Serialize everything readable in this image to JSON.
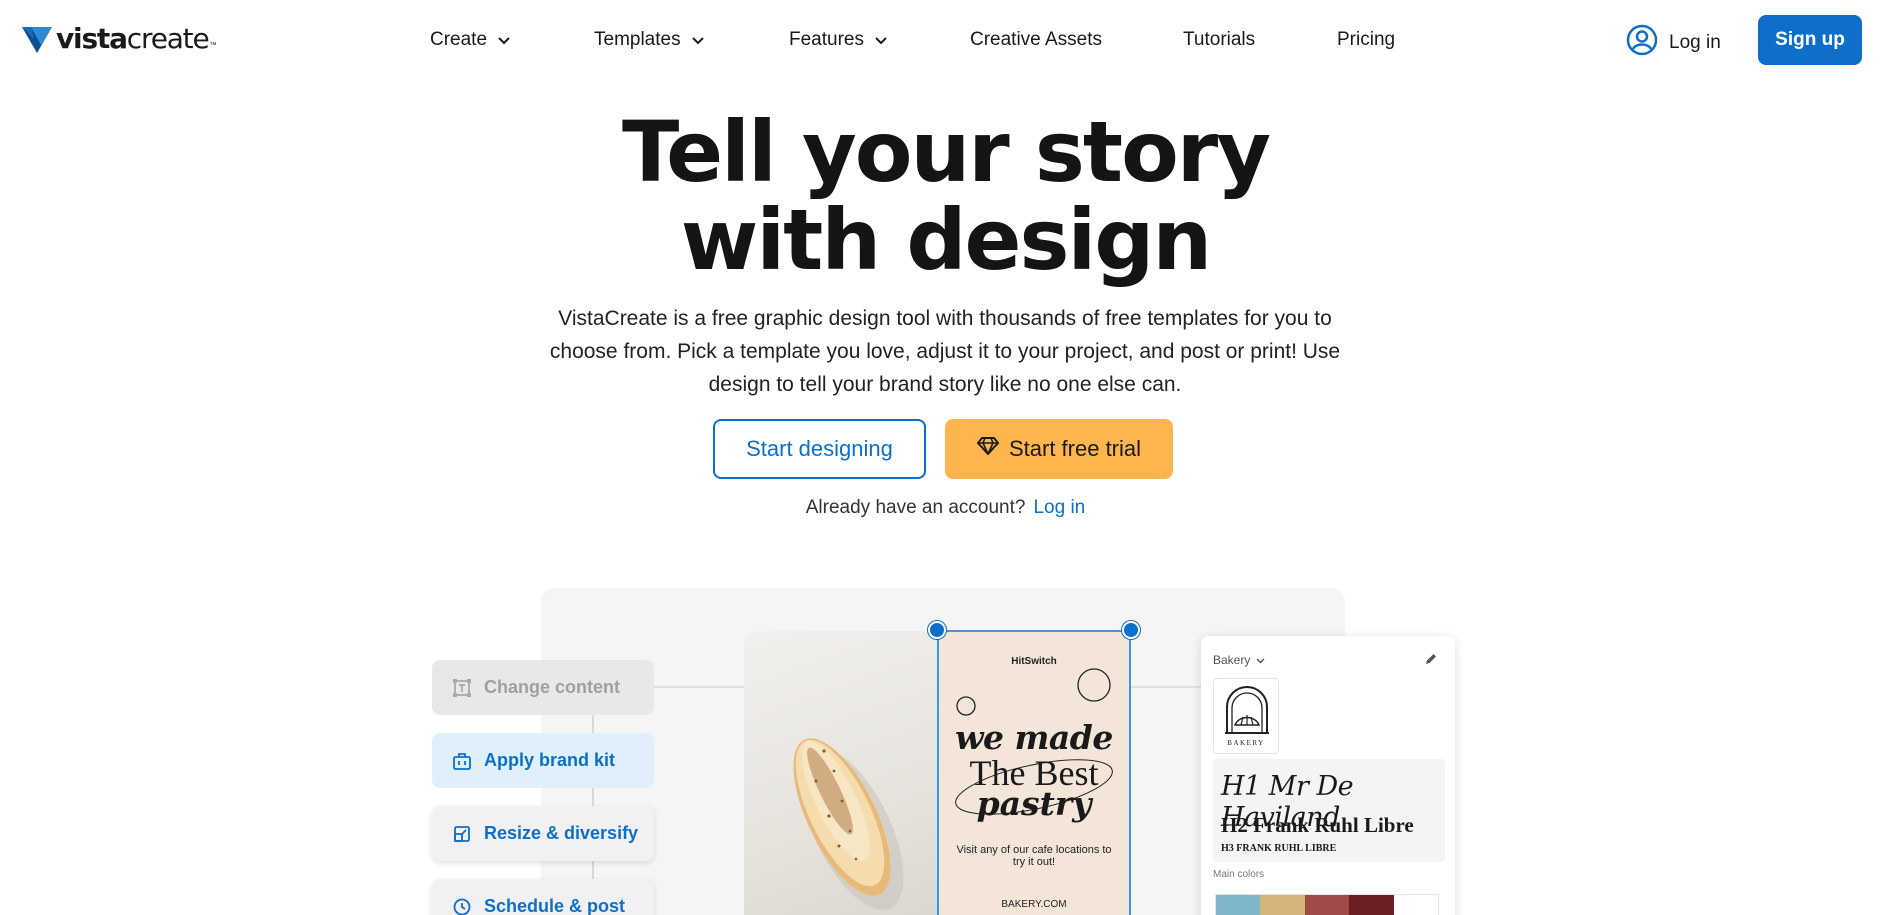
{
  "header": {
    "logo": {
      "text_bold": "vista",
      "text_light": "create",
      "tm": "™"
    },
    "nav": [
      {
        "label": "Create",
        "has_dropdown": true
      },
      {
        "label": "Templates",
        "has_dropdown": true
      },
      {
        "label": "Features",
        "has_dropdown": true
      },
      {
        "label": "Creative Assets",
        "has_dropdown": false
      },
      {
        "label": "Tutorials",
        "has_dropdown": false
      },
      {
        "label": "Pricing",
        "has_dropdown": false
      }
    ],
    "login_label": "Log in",
    "signup_label": "Sign up",
    "icons": {
      "dropdown": "chevron-down-icon",
      "user": "user-circle-icon"
    }
  },
  "hero": {
    "title_line1": "Tell your story",
    "title_line2": "with design",
    "subtitle": "VistaCreate is a free graphic design tool with thousands of free templates for you to choose from. Pick a template you love, adjust it to your project, and post or print! Use design to tell your brand story like no one else can.",
    "start_designing": "Start designing",
    "start_trial": "Start free trial",
    "already_text": "Already have an account?",
    "login_link": "Log in"
  },
  "illustration": {
    "steps": [
      {
        "label": "Change content",
        "icon": "text-frame-icon",
        "state": "disabled"
      },
      {
        "label": "Apply brand kit",
        "icon": "briefcase-icon",
        "state": "active"
      },
      {
        "label": "Resize & diversify",
        "icon": "resize-icon",
        "state": "default"
      },
      {
        "label": "Schedule & post",
        "icon": "clock-icon",
        "state": "default"
      }
    ],
    "card": {
      "brand": "HitSwitch",
      "title_line1": "we made",
      "title_line2": "The Best",
      "title_line3": "pastry",
      "text": "Visit any of our cafe locations to try it out!",
      "url": "BAKERY.COM"
    },
    "brand_panel": {
      "dropdown_label": "Bakery",
      "logo_text": "BAKERY",
      "font_h1": "H1 Mr De Haviland",
      "font_h2": "H2 Frank Ruhl Libre",
      "font_h3": "H3 FRANK RUHL LIBRE",
      "main_colors_label": "Main colors",
      "colors": [
        "#7fb6c9",
        "#d5b47a",
        "#a04a4a",
        "#6d1f23",
        "#ffffff"
      ]
    }
  },
  "colors": {
    "accent_blue": "#0d6fc9",
    "trial_orange": "#ffb54d",
    "text_dark": "#141414"
  }
}
